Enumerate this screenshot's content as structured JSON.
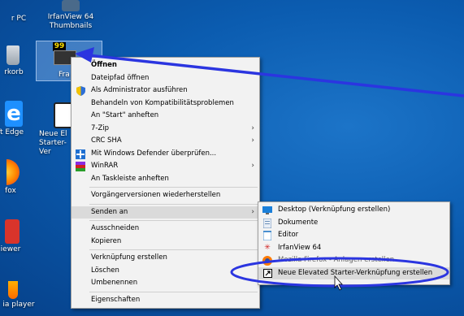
{
  "desktop": {
    "icons": [
      {
        "label": "r PC"
      },
      {
        "label": "IrfanView 64 Thumbnails"
      },
      {
        "label": "rkorb"
      },
      {
        "label": "Fra"
      },
      {
        "label": "ft Edge"
      },
      {
        "label": "Neue El Starter-Ver"
      },
      {
        "label": "fox"
      },
      {
        "label": "iewer"
      },
      {
        "label": "ia player"
      }
    ]
  },
  "context_menu": {
    "items": [
      {
        "label": "Öffnen",
        "bold": true
      },
      {
        "label": "Dateipfad öffnen"
      },
      {
        "label": "Als Administrator ausführen",
        "icon": "shield-icon"
      },
      {
        "label": "Behandeln von Kompatibilitätsproblemen"
      },
      {
        "label": "An \"Start\" anheften"
      },
      {
        "label": "7-Zip",
        "submenu": true
      },
      {
        "label": "CRC SHA",
        "submenu": true
      },
      {
        "label": "Mit Windows Defender überprüfen...",
        "icon": "defender-icon"
      },
      {
        "label": "WinRAR",
        "icon": "winrar-icon",
        "submenu": true
      },
      {
        "label": "An Taskleiste anheften"
      },
      {
        "label": "Vorgängerversionen wiederherstellen"
      },
      {
        "label": "Senden an",
        "submenu": true
      },
      {
        "label": "Ausschneiden"
      },
      {
        "label": "Kopieren"
      },
      {
        "label": "Verknüpfung erstellen"
      },
      {
        "label": "Löschen"
      },
      {
        "label": "Umbenennen"
      },
      {
        "label": "Eigenschaften"
      }
    ]
  },
  "sendto_menu": {
    "items": [
      {
        "label": "Desktop (Verknüpfung erstellen)",
        "icon": "desktop-icon"
      },
      {
        "label": "Dokumente",
        "icon": "documents-icon"
      },
      {
        "label": "Editor",
        "icon": "notepad-icon"
      },
      {
        "label": "IrfanView 64",
        "icon": "irfanview-icon"
      },
      {
        "label": "Mozilla Firefox - Anlagen erstellen",
        "icon": "firefox-icon"
      },
      {
        "label": "Neue Elevated Starter-Verknüpfung erstellen",
        "icon": "shortcut-icon"
      }
    ]
  },
  "colors": {
    "annotation": "#2b35e0",
    "highlight": "#dadada"
  }
}
